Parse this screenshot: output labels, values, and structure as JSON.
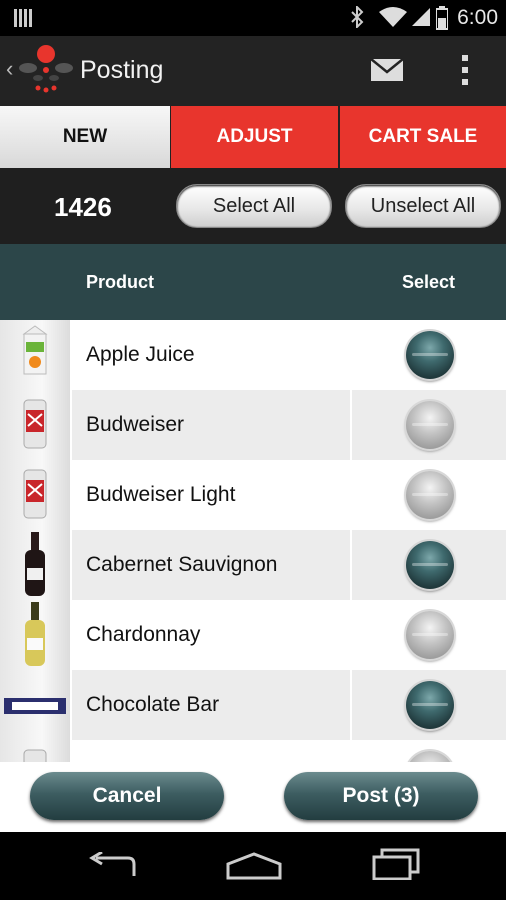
{
  "status_bar": {
    "time": "6:00",
    "icons": [
      "signal-bars-icon",
      "bluetooth-icon",
      "wifi-icon",
      "cell-signal-icon",
      "battery-icon"
    ]
  },
  "action_bar": {
    "title": "Posting",
    "icons": [
      "back-chevron-icon",
      "app-logo-icon",
      "mail-icon",
      "overflow-menu-icon"
    ]
  },
  "tabs": [
    {
      "label": "NEW",
      "selected": true
    },
    {
      "label": "ADJUST",
      "selected": false
    },
    {
      "label": "CART SALE",
      "selected": false
    }
  ],
  "selection_bar": {
    "count": "1426",
    "select_all": "Select All",
    "unselect_all": "Unselect All"
  },
  "table": {
    "headers": {
      "product": "Product",
      "select": "Select"
    },
    "rows": [
      {
        "name": "Apple Juice",
        "selected": true,
        "thumb": "juice-carton"
      },
      {
        "name": "Budweiser",
        "selected": false,
        "thumb": "beer-can"
      },
      {
        "name": "Budweiser Light",
        "selected": false,
        "thumb": "beer-can"
      },
      {
        "name": "Cabernet Sauvignon",
        "selected": true,
        "thumb": "red-wine-bottle"
      },
      {
        "name": "Chardonnay",
        "selected": false,
        "thumb": "white-wine-bottle"
      },
      {
        "name": "Chocolate Bar",
        "selected": true,
        "thumb": "candy-bar"
      },
      {
        "name": "",
        "selected": false,
        "thumb": "beer-can"
      }
    ]
  },
  "footer": {
    "cancel": "Cancel",
    "post": "Post (3)"
  },
  "nav_bar": {
    "icons": [
      "back-icon",
      "home-icon",
      "recents-icon"
    ]
  },
  "colors": {
    "accent": "#e8352d",
    "header_teal": "#2c4649",
    "button_teal": "#3d5d61"
  }
}
